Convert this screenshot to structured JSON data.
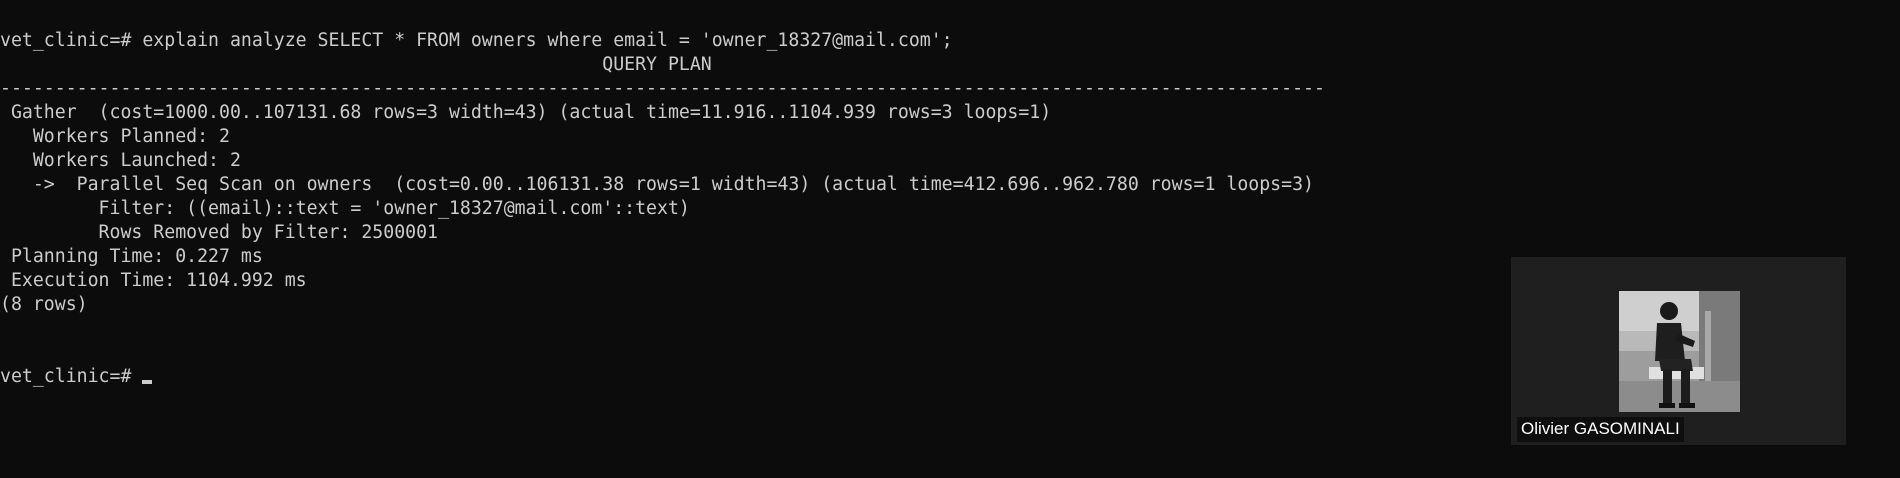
{
  "terminal": {
    "lines": [
      "vet_clinic=# explain analyze SELECT * FROM owners where email = 'owner_18327@mail.com';",
      "                                                       QUERY PLAN",
      "-------------------------------------------------------------------------------------------------------------------------",
      " Gather  (cost=1000.00..107131.68 rows=3 width=43) (actual time=11.916..1104.939 rows=3 loops=1)",
      "   Workers Planned: 2",
      "   Workers Launched: 2",
      "   ->  Parallel Seq Scan on owners  (cost=0.00..106131.38 rows=1 width=43) (actual time=412.696..962.780 rows=1 loops=3)",
      "         Filter: ((email)::text = 'owner_18327@mail.com'::text)",
      "         Rows Removed by Filter: 2500001",
      " Planning Time: 0.227 ms",
      " Execution Time: 1104.992 ms",
      "(8 rows)",
      "",
      "",
      "vet_clinic=# "
    ]
  },
  "video": {
    "participant_name": "Olivier GASOMINALI"
  },
  "colors": {
    "background": "#0c0c0c",
    "text": "#cccccc",
    "tile": "#1f1f1f"
  }
}
